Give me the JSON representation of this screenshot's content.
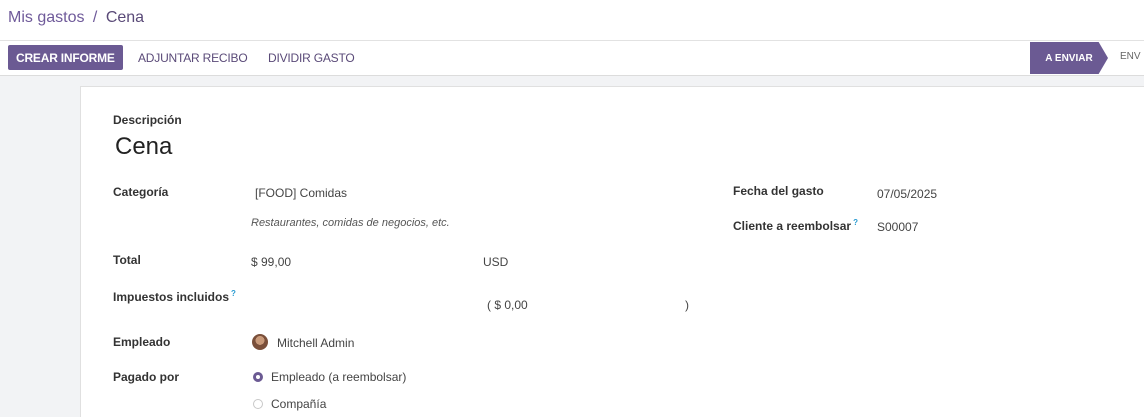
{
  "breadcrumb": {
    "parent": "Mis gastos",
    "separator": "/",
    "current": "Cena"
  },
  "toolbar": {
    "create_report": "CREAR INFORME",
    "attach_receipt": "ADJUNTAR RECIBO",
    "split_expense": "DIVIDIR GASTO"
  },
  "status": {
    "active": "A ENVIAR",
    "next": "ENV"
  },
  "form": {
    "description_label": "Descripción",
    "description_value": "Cena",
    "category_label": "Categoría",
    "category_value": "[FOOD] Comidas",
    "category_hint": "Restaurantes, comidas de negocios, etc.",
    "total_label": "Total",
    "total_value": "$ 99,00",
    "currency": "USD",
    "taxes_label": "Impuestos incluidos",
    "taxes_help": "?",
    "taxes_value": "( $ 0,00",
    "taxes_close": ")",
    "employee_label": "Empleado",
    "employee_value": "Mitchell Admin",
    "paid_by_label": "Pagado por",
    "paid_by_options": [
      {
        "label": "Empleado (a reembolsar)",
        "checked": true
      },
      {
        "label": "Compañía",
        "checked": false
      }
    ],
    "expense_date_label": "Fecha del gasto",
    "expense_date_value": "07/05/2025",
    "customer_label": "Cliente a reembolsar",
    "customer_help": "?",
    "customer_value": "S00007"
  },
  "colors": {
    "primary": "#6b5a93",
    "help": "#2a9bd1"
  }
}
